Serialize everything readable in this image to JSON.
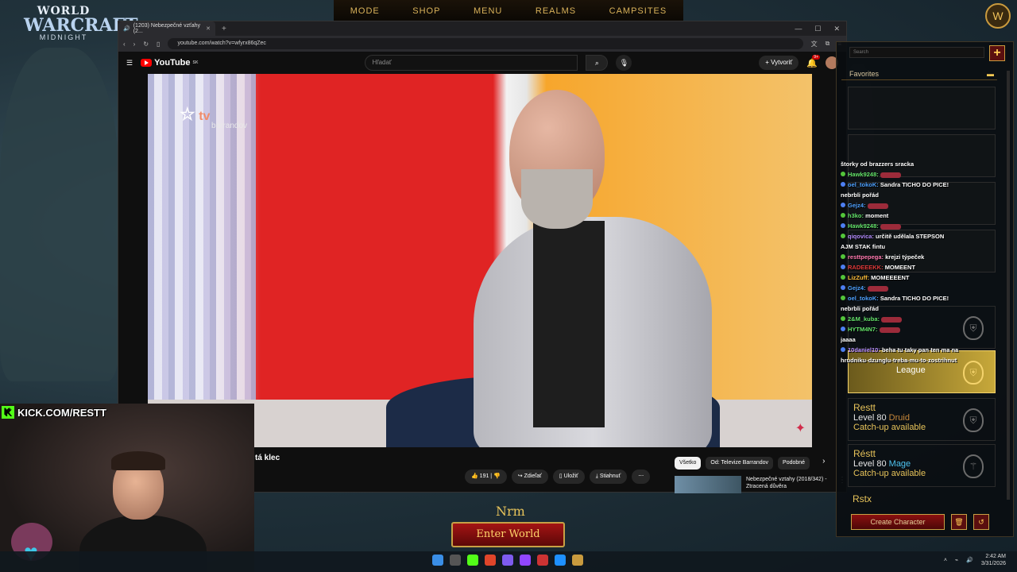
{
  "wow": {
    "nav": [
      "MODE",
      "SHOP",
      "MENU",
      "REALMS",
      "CAMPSITES"
    ],
    "logo": {
      "line1": "WORLD",
      "line2": "WARCRAFT",
      "line3": "MIDNIGHT"
    },
    "realm": "Nrm",
    "enter_world": "Enter World",
    "search_placeholder": "Search",
    "favorites_label": "Favorites",
    "characters": [
      {
        "name": "Restt",
        "level": "Level 80",
        "class": "Druid",
        "status": "Catch-up available"
      },
      {
        "name": "Réstt",
        "level": "Level 80",
        "class": "Mage",
        "status": "Catch-up available"
      },
      {
        "name": "Rstx",
        "level": "",
        "class": "",
        "status": ""
      }
    ],
    "selected_partial": "League",
    "create_character": "Create Character"
  },
  "browser": {
    "tab_title": "(1203) Nebezpečné vzťahy (2...",
    "url": "youtube.com/watch?v=wfyrx86qZec"
  },
  "youtube": {
    "logo": "YouTube",
    "logo_sup": "SK",
    "search_placeholder": "Hľadať",
    "create": "Vytvoriť",
    "notif_count": "9+",
    "video_title": "tá klec",
    "channel_watermark": "tv",
    "channel_watermark_sub": "barrandov",
    "likes": "191",
    "share": "Zdieľať",
    "save": "Uložiť",
    "download": "Stiahnuť",
    "chips": [
      "Všetko",
      "Od: Televize Barrandov",
      "Podobné"
    ],
    "recommendation": {
      "title": "Nebezpečné vztahy (2018/342) - Ztracená důvěra"
    }
  },
  "stream": {
    "kick": "KICK.COM/RESTT"
  },
  "chat": [
    {
      "user": "",
      "text": "štorky od brazzers sracka",
      "color": "#ffffff"
    },
    {
      "user": "Hawk9248:",
      "text": "",
      "color": "#64e36b"
    },
    {
      "user": "oel_tokoK:",
      "text": "Sandra TICHO DO PICE!",
      "color": "#4ea1ff"
    },
    {
      "user": "",
      "text": "nebrbli pořád",
      "color": "#ffffff"
    },
    {
      "user": "Gejz4:",
      "text": "",
      "color": "#4ea1ff"
    },
    {
      "user": "h3ko:",
      "text": "moment",
      "color": "#64e36b"
    },
    {
      "user": "Hawk9248:",
      "text": "",
      "color": "#64e36b"
    },
    {
      "user": "qiqovica:",
      "text": "určitě udělala STEPSON",
      "color": "#b48cff"
    },
    {
      "user": "",
      "text": "AJM STAK fintu",
      "color": "#ffffff"
    },
    {
      "user": "resttpepega:",
      "text": "krejzi týpeček",
      "color": "#ff7ab0"
    },
    {
      "user": "RADEEEKK:",
      "text": "MOMEENT",
      "color": "#e03a3a"
    },
    {
      "user": "LizZuff:",
      "text": "MOMEEEENT",
      "color": "#ffbf3a"
    },
    {
      "user": "Gejz4:",
      "text": "",
      "color": "#4ea1ff"
    },
    {
      "user": "oel_tokoK:",
      "text": "Sandra TICHO DO PICE!",
      "color": "#4ea1ff"
    },
    {
      "user": "",
      "text": "nebrbli pořád",
      "color": "#ffffff"
    },
    {
      "user": "2&M_kuba:",
      "text": "",
      "color": "#64e36b"
    },
    {
      "user": "HYTM4N7:",
      "text": "",
      "color": "#64e36b"
    },
    {
      "user": "",
      "text": "jaaaa",
      "color": "#ffffff"
    },
    {
      "user": "10daniel10:",
      "text": "beha tu taky pan ten ma na",
      "color": "#b48cff"
    },
    {
      "user": "",
      "text": "hrudniku-dzunglu-treba-mu-to-zostrihnut",
      "color": "#ffffff"
    }
  ],
  "taskbar": {
    "time": "2:42 AM",
    "date": "3/31/2026"
  }
}
